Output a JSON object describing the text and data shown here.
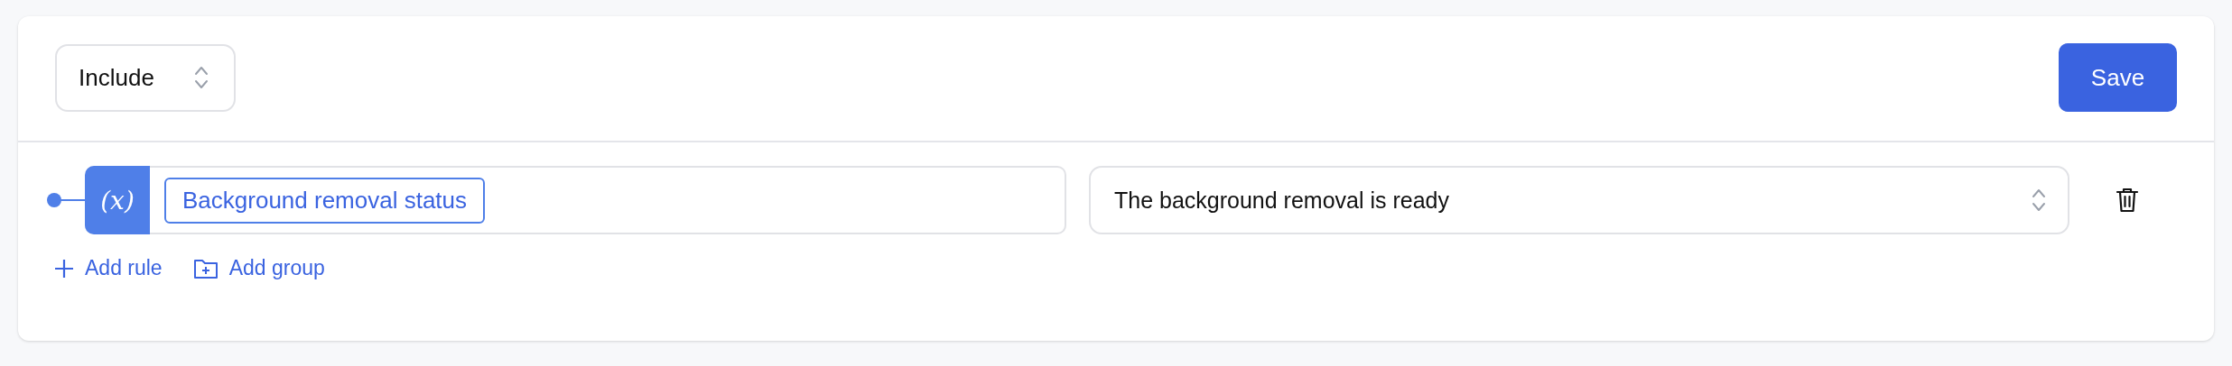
{
  "mode_select": {
    "value": "Include"
  },
  "save_button": {
    "label": "Save"
  },
  "rules": [
    {
      "variable_symbol": "(x)",
      "variable": "Background removal status",
      "value": "The background removal is ready"
    }
  ],
  "actions": [
    {
      "kind": "rule",
      "label": "Add rule"
    },
    {
      "kind": "group",
      "label": "Add group"
    }
  ]
}
